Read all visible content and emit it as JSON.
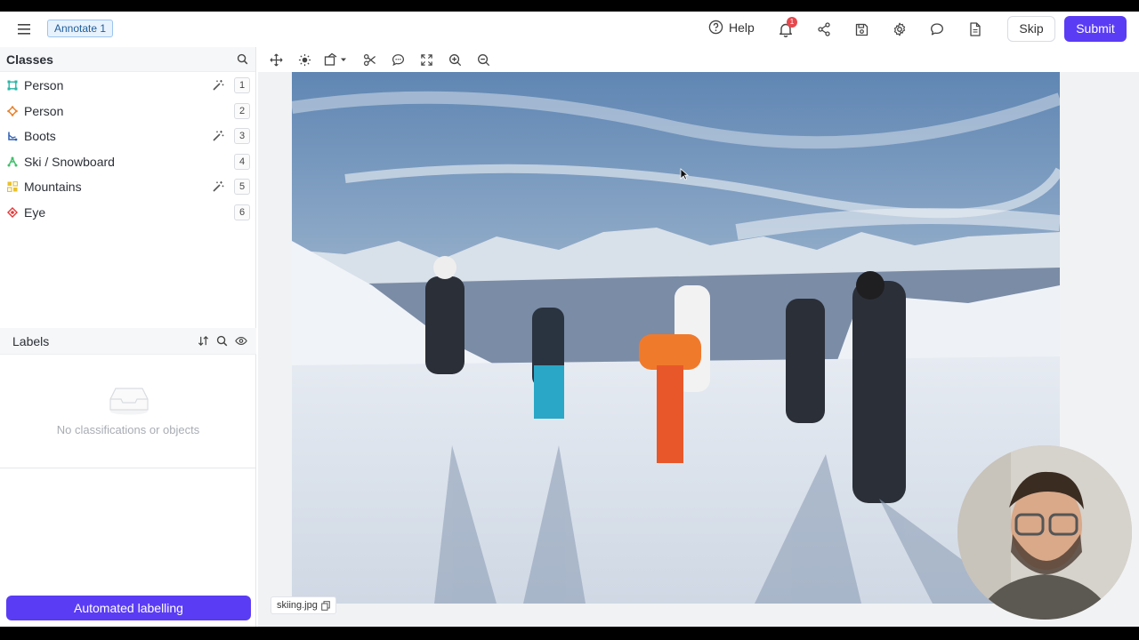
{
  "topbar": {
    "task_badge": "Annotate 1",
    "help_label": "Help",
    "notification_count": "1",
    "skip_label": "Skip",
    "submit_label": "Submit"
  },
  "classes": {
    "title": "Classes",
    "items": [
      {
        "name": "Person",
        "hotkey": "1",
        "color": "#2bb5a6",
        "icon": "bounding-box-icon",
        "has_wand": true
      },
      {
        "name": "Person",
        "hotkey": "2",
        "color": "#e8842f",
        "icon": "polygon-icon",
        "has_wand": false
      },
      {
        "name": "Boots",
        "hotkey": "3",
        "color": "#2f5fb3",
        "icon": "polyline-icon",
        "has_wand": true
      },
      {
        "name": "Ski / Snowboard",
        "hotkey": "4",
        "color": "#3fbf6a",
        "icon": "keypoint-skeleton-icon",
        "has_wand": false
      },
      {
        "name": "Mountains",
        "hotkey": "5",
        "color": "#e8c22f",
        "icon": "segmentation-grid-icon",
        "has_wand": true
      },
      {
        "name": "Eye",
        "hotkey": "6",
        "color": "#e03a3a",
        "icon": "point-icon",
        "has_wand": false
      }
    ]
  },
  "labels": {
    "title": "Labels",
    "empty_text": "No classifications or objects"
  },
  "automated_label": "Automated labelling",
  "image": {
    "filename": "skiing.jpg"
  }
}
